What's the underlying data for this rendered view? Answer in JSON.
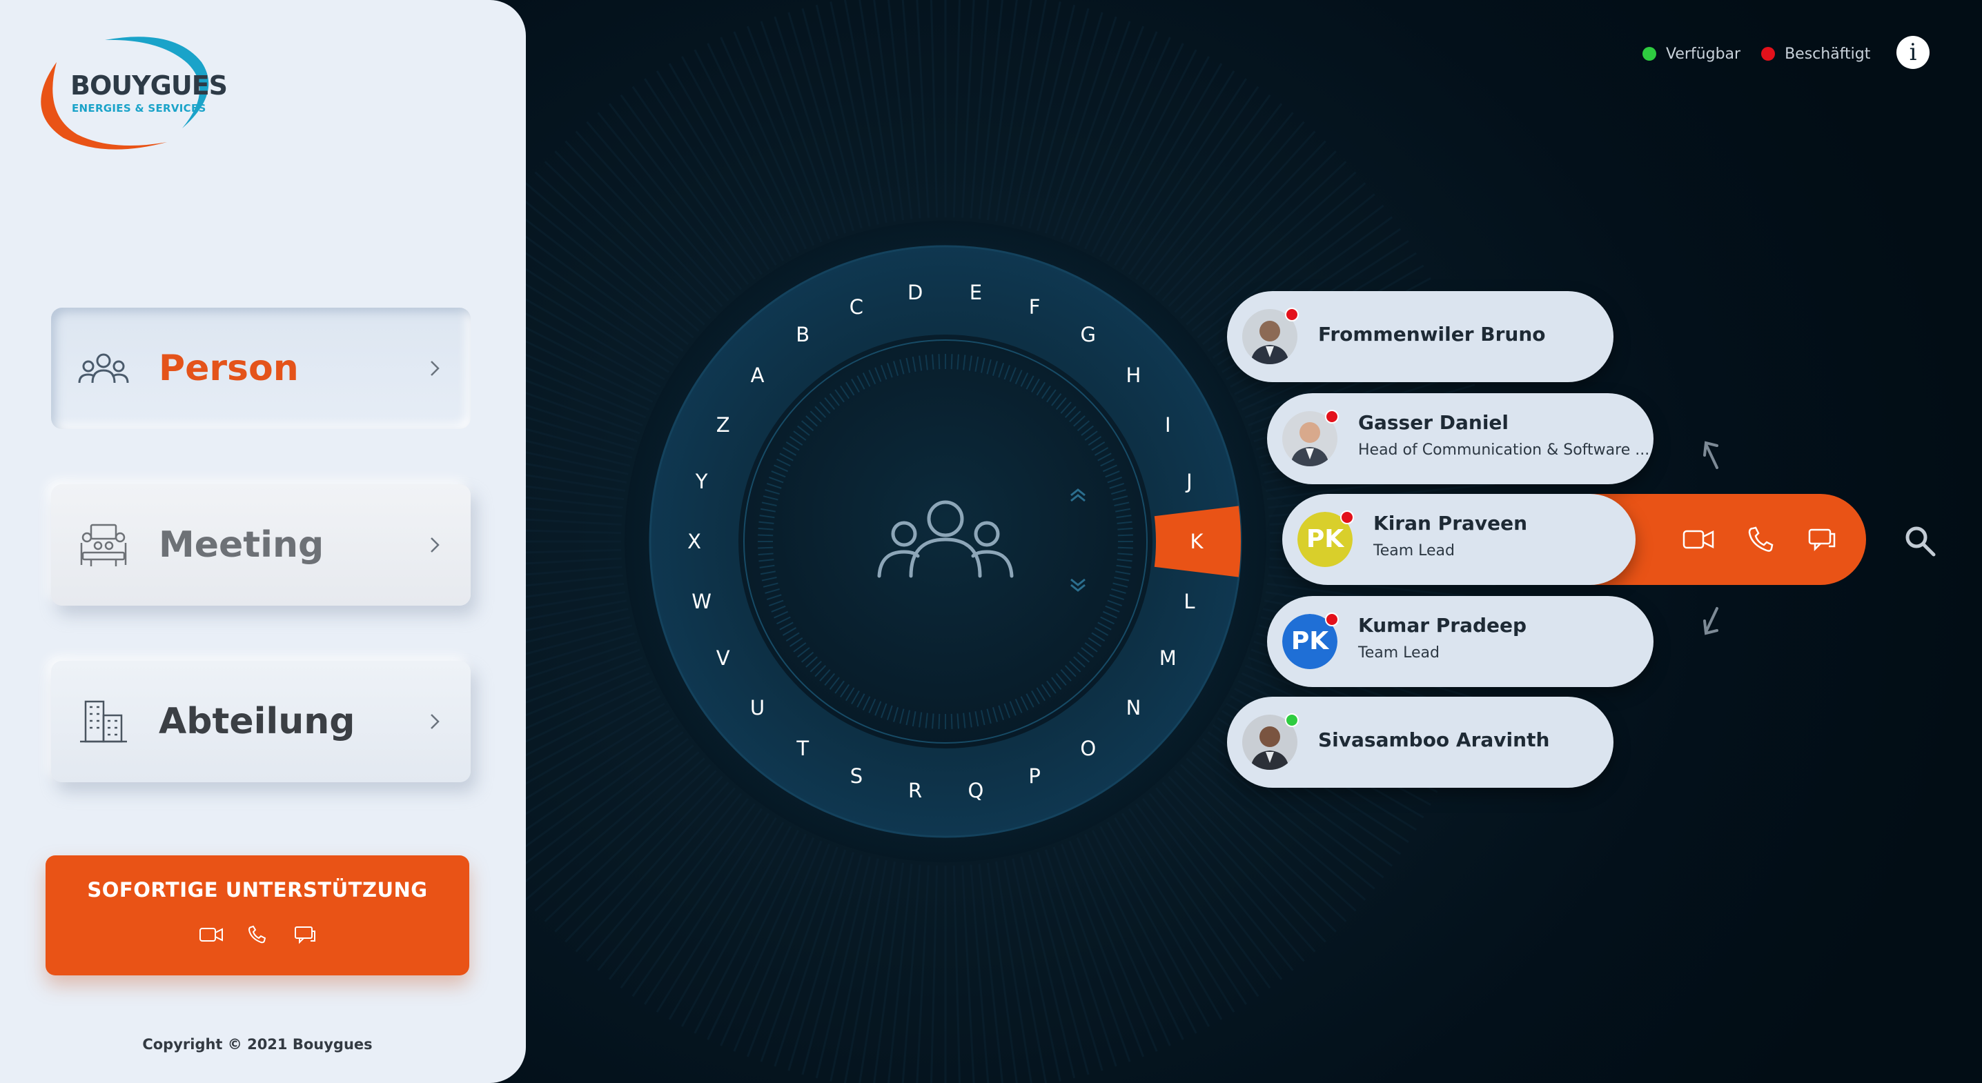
{
  "brand": {
    "name": "BOUYGUES",
    "tagline": "ENERGIES & SERVICES"
  },
  "nav": {
    "person": "Person",
    "meeting": "Meeting",
    "department": "Abteilung"
  },
  "support": {
    "title": "SOFORTIGE UNTERSTÜTZUNG"
  },
  "footer": {
    "copyright": "Copyright © 2021 Bouygues"
  },
  "status_legend": [
    {
      "label": "Verfügbar",
      "color": "#2ecc40"
    },
    {
      "label": "Beschäftigt",
      "color": "#e3111b"
    }
  ],
  "info": {
    "label": "i"
  },
  "alphabet": {
    "letters": [
      "A",
      "B",
      "C",
      "D",
      "E",
      "F",
      "G",
      "H",
      "I",
      "J",
      "K",
      "L",
      "M",
      "N",
      "O",
      "P",
      "Q",
      "R",
      "S",
      "T",
      "U",
      "V",
      "W",
      "X",
      "Y",
      "Z"
    ],
    "selected": "K"
  },
  "contacts": [
    {
      "name": "Frommenwiler Bruno",
      "role": "",
      "status": "busy",
      "initials": ""
    },
    {
      "name": "Gasser Daniel",
      "role": "Head of Communication & Software ...",
      "status": "busy",
      "initials": ""
    },
    {
      "name": "Kiran Praveen",
      "role": "Team Lead",
      "status": "busy",
      "initials": "PK",
      "avatar_color": "#d9cf2b",
      "selected": true
    },
    {
      "name": "Kumar Pradeep",
      "role": "Team Lead",
      "status": "busy",
      "initials": "PK",
      "avatar_color": "#1f6fd6"
    },
    {
      "name": "Sivasamboo Aravinth",
      "role": "",
      "status": "available",
      "initials": ""
    }
  ],
  "colors": {
    "accent": "#e95316",
    "available": "#2ecc40",
    "busy": "#e3111b",
    "pill": "#dbe4ef"
  },
  "icons": {
    "video": "video-icon",
    "phone": "phone-icon",
    "chat": "chat-icon",
    "search": "search-icon",
    "group": "group-icon"
  }
}
